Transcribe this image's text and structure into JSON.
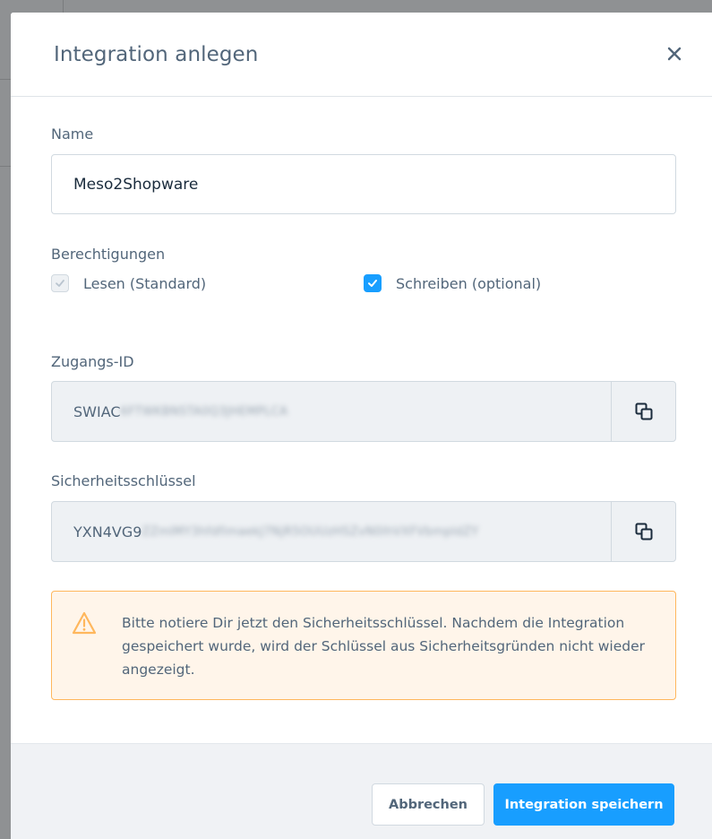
{
  "modal": {
    "title": "Integration anlegen"
  },
  "form": {
    "name_label": "Name",
    "name_value": "Meso2Shopware",
    "permissions_label": "Berechtigungen",
    "read_label": "Lesen (Standard)",
    "read_checked": true,
    "read_disabled": true,
    "write_label": "Schreiben (optional)",
    "write_checked": true,
    "access_id_label": "Zugangs-ID",
    "access_id_visible": "SWIAC",
    "access_id_obscured": "6FTWKBNSTA0Q3JHEMPLCA",
    "secret_key_label": "Sicherheitsschlüssel",
    "secret_key_visible": "YXN4VG9",
    "secret_key_obscured": "ZZmIMY3hfdfimaekJ7NjR5OUUzHSZvN0lhVXFVbmpldZY"
  },
  "warning": {
    "text": "Bitte notiere Dir jetzt den Sicherheitsschlüssel. Nachdem die Integration gespeichert wurde, wird der Schlüssel aus Sicherheitsgründen nicht wieder angezeigt.",
    "color": "#ffb75d"
  },
  "footer": {
    "cancel_label": "Abbrechen",
    "save_label": "Integration speichern"
  },
  "colors": {
    "primary": "#189eff",
    "text": "#52667a",
    "warning_bg": "#fff5ea"
  },
  "icons": {
    "close": "close-icon",
    "copy": "copy-icon",
    "warning": "warning-triangle-icon",
    "check": "checkmark-icon"
  }
}
